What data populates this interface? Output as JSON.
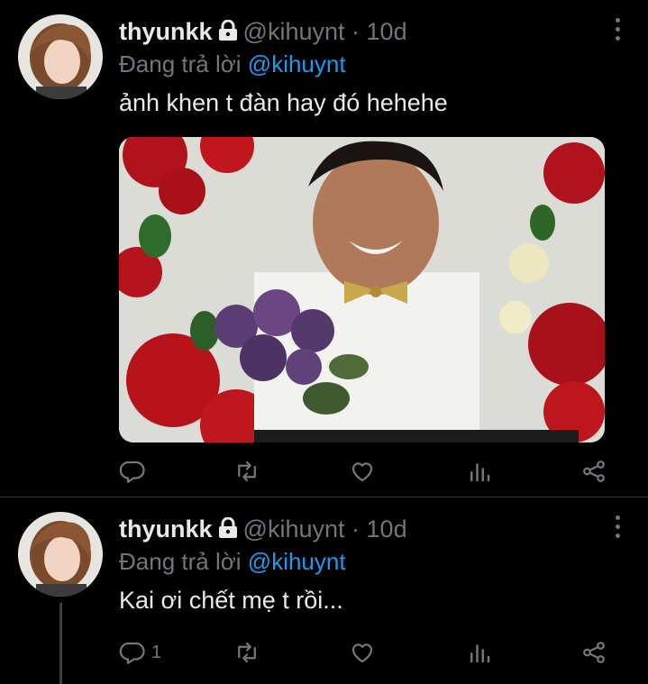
{
  "tweets": [
    {
      "author_name": "thyunkk",
      "handle": "@kihuynt",
      "separator": "·",
      "time": "10d",
      "replying_prefix": "Đang trả lời",
      "replying_to": "@kihuynt",
      "text": "ảnh khen t đàn hay đó hehehe",
      "reply_count": "",
      "retweet_count": "",
      "like_count": "",
      "views_count": ""
    },
    {
      "author_name": "thyunkk",
      "handle": "@kihuynt",
      "separator": "·",
      "time": "10d",
      "replying_prefix": "Đang trả lời",
      "replying_to": "@kihuynt",
      "text": "Kai ơi chết mẹ t rồi...",
      "reply_count": "1",
      "retweet_count": "",
      "like_count": "",
      "views_count": ""
    }
  ],
  "icons": {
    "protected": "lock-icon",
    "more": "more-vertical-icon",
    "reply": "reply-icon",
    "retweet": "retweet-icon",
    "like": "heart-icon",
    "views": "analytics-icon",
    "share": "share-icon"
  },
  "colors": {
    "background": "#000000",
    "text": "#e7e9ea",
    "muted": "#71767b",
    "link": "#1d9bf0",
    "divider": "#2f3336"
  }
}
